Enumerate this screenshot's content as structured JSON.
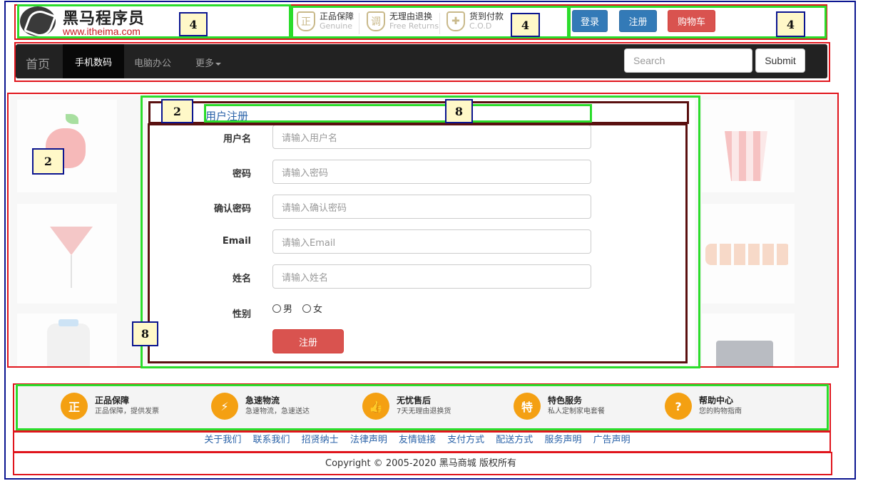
{
  "header": {
    "logo": {
      "name": "黑马程序员",
      "url": "www.itheima.com"
    },
    "guarantees": [
      {
        "icon": "正",
        "title": "正品保障",
        "subtitle": "Genuine"
      },
      {
        "icon": "调",
        "title": "无理由退换",
        "subtitle": "Free Returns"
      },
      {
        "icon": "gift-icon",
        "title": "货到付款",
        "subtitle": "C.O.D"
      }
    ],
    "buttons": {
      "login": "登录",
      "register": "注册",
      "cart": "购物车"
    }
  },
  "navbar": {
    "brand": "首页",
    "items": [
      {
        "label": "手机数码",
        "active": true
      },
      {
        "label": "电脑办公",
        "active": false
      },
      {
        "label": "更多",
        "active": false,
        "dropdown": true
      }
    ],
    "search_placeholder": "Search",
    "submit_label": "Submit"
  },
  "form": {
    "title": "用户注册",
    "fields": [
      {
        "label": "用户名",
        "placeholder": "请输入用户名"
      },
      {
        "label": "密码",
        "placeholder": "请输入密码"
      },
      {
        "label": "确认密码",
        "placeholder": "请输入确认密码"
      },
      {
        "label": "Email",
        "placeholder": "请输入Email"
      },
      {
        "label": "姓名",
        "placeholder": "请输入姓名"
      }
    ],
    "gender": {
      "label": "性别",
      "options": [
        "男",
        "女"
      ]
    },
    "submit_label": "注册"
  },
  "features": [
    {
      "icon": "正",
      "title": "正品保障",
      "desc": "正品保障，提供发票"
    },
    {
      "icon": "⚡",
      "title": "急速物流",
      "desc": "急速物流，急速送达"
    },
    {
      "icon": "👍",
      "title": "无忧售后",
      "desc": "7天无理由退换货"
    },
    {
      "icon": "特",
      "title": "特色服务",
      "desc": "私人定制家电套餐"
    },
    {
      "icon": "?",
      "title": "帮助中心",
      "desc": "您的购物指南"
    }
  ],
  "footer_links": [
    "关于我们",
    "联系我们",
    "招贤纳士",
    "法律声明",
    "友情链接",
    "支付方式",
    "配送方式",
    "服务声明",
    "广告声明"
  ],
  "copyright": "Copyright © 2005-2020 黑马商城 版权所有",
  "annotations": [
    "4",
    "4",
    "4",
    "2",
    "8",
    "2",
    "8"
  ],
  "colors": {
    "outline_navy": "#0b1590",
    "outline_red": "#e0151c",
    "outline_green": "#2bdc2b",
    "primary_blue": "#337ab7",
    "danger_red": "#d9534f",
    "accent_orange": "#f4a012"
  }
}
